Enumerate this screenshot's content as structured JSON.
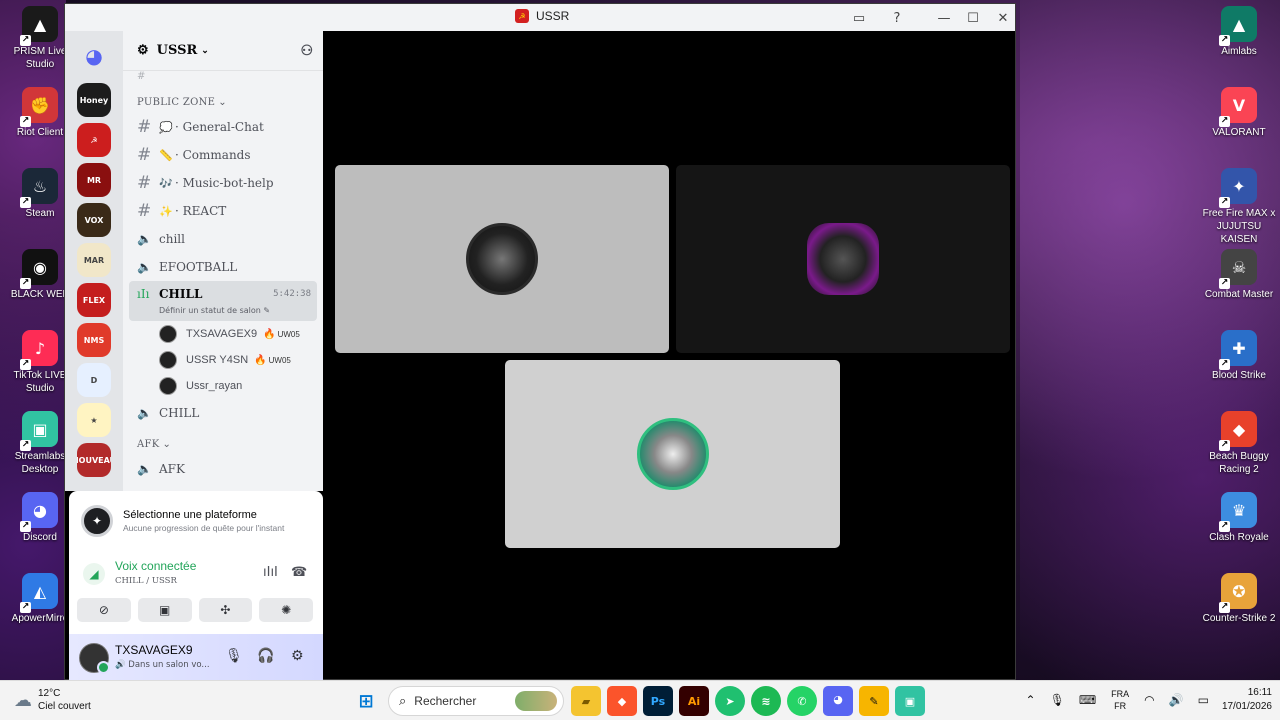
{
  "desktop": {
    "left_icons": [
      {
        "label": "PRISM Live Studio",
        "glyph": "▲",
        "color": "#1a1a1a"
      },
      {
        "label": "Riot Client",
        "glyph": "✊",
        "color": "#d13639"
      },
      {
        "label": "Steam",
        "glyph": "♨",
        "color": "#1b2838"
      },
      {
        "label": "BLACK WEB",
        "glyph": "◉",
        "color": "#111111"
      },
      {
        "label": "TikTok LIVE Studio",
        "glyph": "♪",
        "color": "#fe2c55"
      },
      {
        "label": "Streamlabs Desktop",
        "glyph": "▣",
        "color": "#31c3a2"
      },
      {
        "label": "Discord",
        "glyph": "◕",
        "color": "#5865f2"
      },
      {
        "label": "ApowerMirro",
        "glyph": "◭",
        "color": "#2f7ae5"
      }
    ],
    "right_icons": [
      {
        "label": "Aimlabs",
        "glyph": "▲",
        "color": "#0f7a66"
      },
      {
        "label": "VALORANT",
        "glyph": "V",
        "color": "#fa4454"
      },
      {
        "label": "Free Fire MAX x JUJUTSU KAISEN",
        "glyph": "✦",
        "color": "#3355aa"
      },
      {
        "label": "Combat Master",
        "glyph": "☠",
        "color": "#444444"
      },
      {
        "label": "Blood Strike",
        "glyph": "✚",
        "color": "#2a6fc9"
      },
      {
        "label": "Beach Buggy Racing 2",
        "glyph": "◆",
        "color": "#e8412b"
      },
      {
        "label": "Clash Royale",
        "glyph": "♛",
        "color": "#3d8de0"
      },
      {
        "label": "Counter-Strike 2",
        "glyph": "✪",
        "color": "#e8a33a"
      }
    ]
  },
  "window": {
    "title": "USSR",
    "flag_glyph": "☭"
  },
  "server_rail": {
    "items": [
      {
        "label": "Honey",
        "color": "#1c1c1c"
      },
      {
        "label": "☭",
        "color": "#cc1e1e"
      },
      {
        "label": "MR",
        "color": "#8a0f0f"
      },
      {
        "label": "VOX",
        "color": "#3a2a18"
      },
      {
        "label": "MAR",
        "color": "#f1e7c9"
      },
      {
        "label": "FLEX",
        "color": "#c41e1e"
      },
      {
        "label": "NMS",
        "color": "#e03a2a"
      },
      {
        "label": "D",
        "color": "#e6f0ff"
      },
      {
        "label": "★",
        "color": "#fff4c2"
      },
      {
        "label": "NOUVEAU",
        "color": "#b22a2a"
      }
    ]
  },
  "channels": {
    "server_name": "USSR",
    "categories": {
      "public": "PUBLIC ZONE",
      "afk": "AFK"
    },
    "text": [
      {
        "emoji": "💭",
        "name": "· General-Chat"
      },
      {
        "emoji": "📏",
        "name": "· Commands"
      },
      {
        "emoji": "🎶",
        "name": "· Music-bot-help"
      },
      {
        "emoji": "✨",
        "name": "· REACT"
      }
    ],
    "voice": [
      "chill",
      "EFOOTBALL"
    ],
    "active_voice": {
      "name": "CHILL",
      "timer": "5:42:38",
      "status": "Définir un statut de salon"
    },
    "voice_users": [
      {
        "name": "TXSAVAGEX9",
        "tag": "UW05"
      },
      {
        "name": "USSR Y4SN",
        "tag": "UW05"
      },
      {
        "name": "Ussr_rayan",
        "tag": ""
      }
    ],
    "voice_after": "CHILL",
    "afk_channel": "AFK"
  },
  "bottom": {
    "quest_title": "Sélectionne une plateforme",
    "quest_sub": "Aucune progression de quête pour l'instant",
    "voice_title": "Voix connectée",
    "voice_sub": "CHILL / USSR",
    "username": "TXSAVAGEX9",
    "user_status": "Dans un salon vo..."
  },
  "taskbar": {
    "temp": "12°C",
    "weather": "Ciel couvert",
    "search_placeholder": "Rechercher",
    "lang_top": "FRA",
    "lang_bottom": "FR",
    "time": "16:11",
    "date": "17/01/2026"
  }
}
